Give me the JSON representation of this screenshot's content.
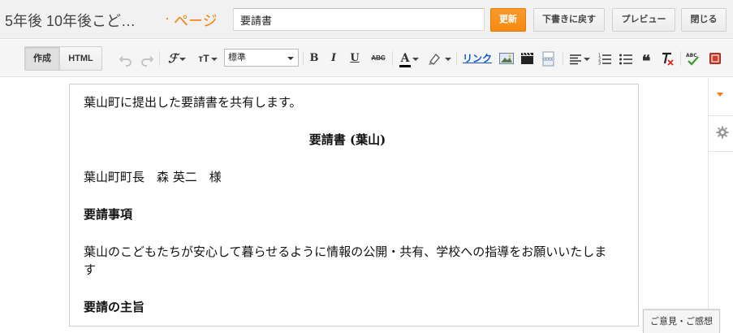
{
  "header": {
    "blog_title": "5年後 10年後こど…",
    "separator": "·",
    "page_label": "ページ",
    "title_value": "要請書",
    "buttons": {
      "update": "更新",
      "revert": "下書きに戻す",
      "preview": "プレビュー",
      "close": "閉じる"
    },
    "accent_color": "#f57d00"
  },
  "toolbar": {
    "modes": {
      "compose": "作成",
      "html": "HTML",
      "active": "作成"
    },
    "font_size_label": "тT",
    "format_selected": "標準",
    "bold": "B",
    "italic": "I",
    "underline": "U",
    "strike": "ABC",
    "text_color_label": "A",
    "link": "リンク",
    "spell_label": "ABC",
    "icons": [
      "undo-icon",
      "redo-icon",
      "font-icon",
      "font-size-icon",
      "text-color-icon",
      "highlight-icon",
      "image-icon",
      "video-icon",
      "jump-break-icon",
      "align-icon",
      "numbered-list-icon",
      "bullet-list-icon",
      "quote-icon",
      "remove-formatting-icon",
      "spellcheck-icon",
      "input-tools-icon"
    ]
  },
  "editor": {
    "paragraphs": [
      {
        "text": "葉山町に提出した要請書を共有します。",
        "style": "normal"
      },
      {
        "text": "要請書 (葉山)",
        "style": "center-bold"
      },
      {
        "text": "葉山町町長　森 英二　様",
        "style": "normal"
      },
      {
        "text": "要請事項",
        "style": "bold"
      },
      {
        "text": "葉山のこどもたちが安心して暮らせるように情報の公開・共有、学校への指導をお願いいたします",
        "style": "normal"
      },
      {
        "text": "要請の主旨",
        "style": "bold"
      }
    ]
  },
  "sidebar": {
    "icons": [
      "collapse-arrow-icon",
      "gear-icon"
    ]
  },
  "feedback": {
    "label": "ご意見・ご感想"
  }
}
